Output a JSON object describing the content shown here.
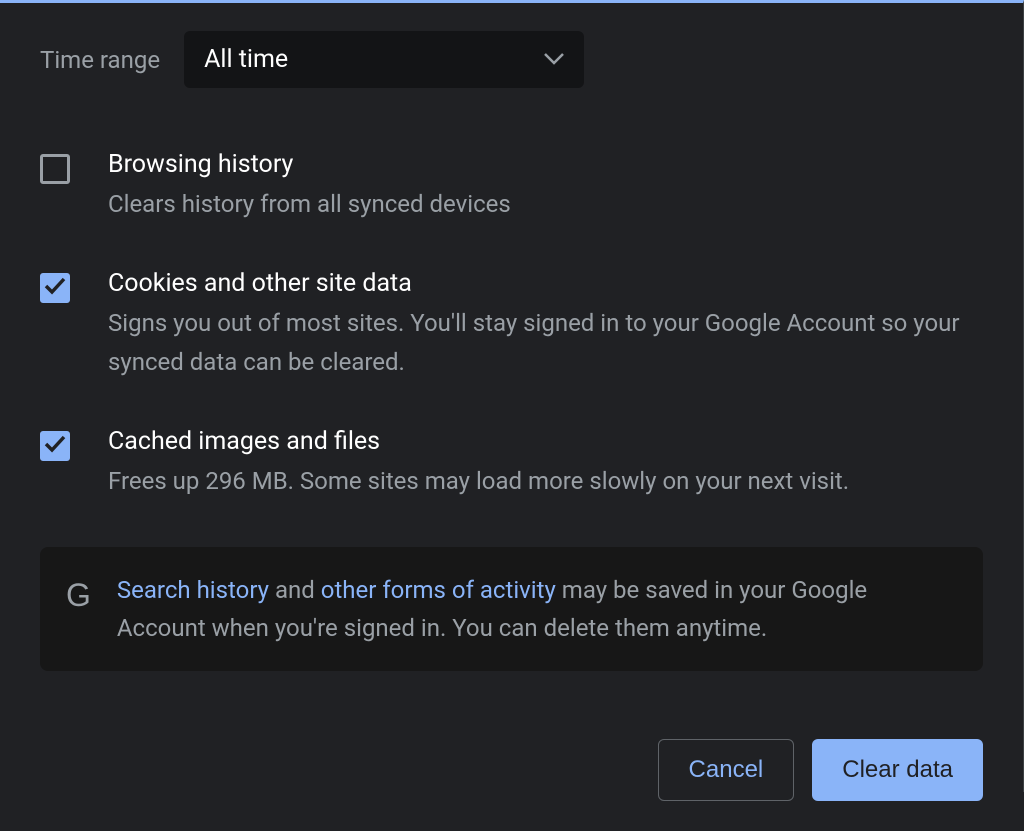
{
  "timeRange": {
    "label": "Time range",
    "selected": "All time"
  },
  "options": [
    {
      "title": "Browsing history",
      "desc": "Clears history from all synced devices",
      "checked": false
    },
    {
      "title": "Cookies and other site data",
      "desc": "Signs you out of most sites. You'll stay signed in to your Google Account so your synced data can be cleared.",
      "checked": true
    },
    {
      "title": "Cached images and files",
      "desc": "Frees up 296 MB. Some sites may load more slowly on your next visit.",
      "checked": true
    }
  ],
  "info": {
    "link1": "Search history",
    "mid1": " and ",
    "link2": "other forms of activity",
    "rest": " may be saved in your Google Account when you're signed in. You can delete them anytime."
  },
  "buttons": {
    "cancel": "Cancel",
    "clear": "Clear data"
  }
}
